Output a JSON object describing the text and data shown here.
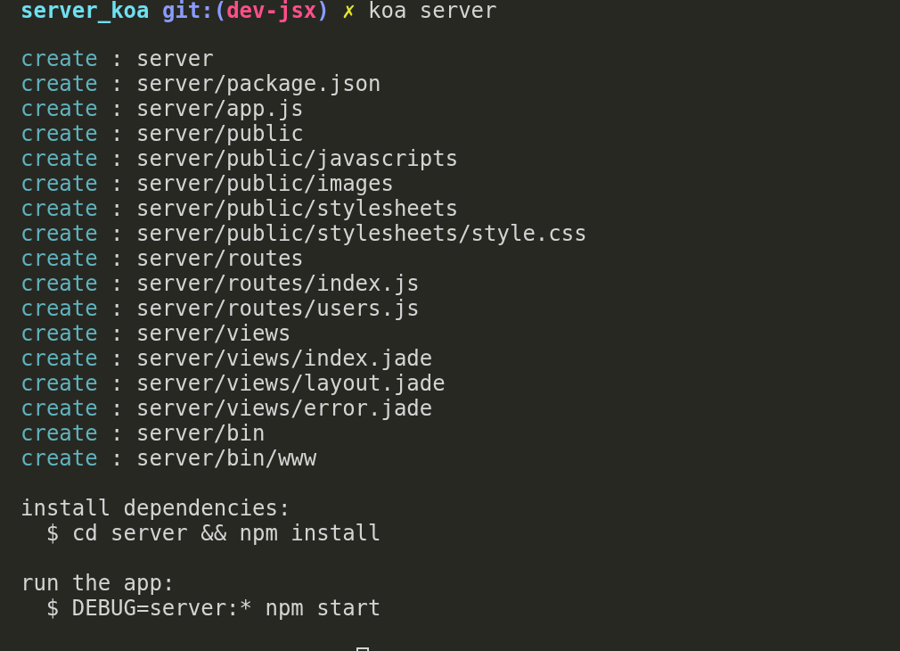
{
  "prompt": {
    "directory": "server_koa",
    "git_prefix": "git:(",
    "branch": "dev-jsx",
    "git_suffix": ")",
    "dirty_mark": "✗",
    "command": "koa server"
  },
  "created": [
    {
      "action": "create",
      "separator": ":",
      "path": "server"
    },
    {
      "action": "create",
      "separator": ":",
      "path": "server/package.json"
    },
    {
      "action": "create",
      "separator": ":",
      "path": "server/app.js"
    },
    {
      "action": "create",
      "separator": ":",
      "path": "server/public"
    },
    {
      "action": "create",
      "separator": ":",
      "path": "server/public/javascripts"
    },
    {
      "action": "create",
      "separator": ":",
      "path": "server/public/images"
    },
    {
      "action": "create",
      "separator": ":",
      "path": "server/public/stylesheets"
    },
    {
      "action": "create",
      "separator": ":",
      "path": "server/public/stylesheets/style.css"
    },
    {
      "action": "create",
      "separator": ":",
      "path": "server/routes"
    },
    {
      "action": "create",
      "separator": ":",
      "path": "server/routes/index.js"
    },
    {
      "action": "create",
      "separator": ":",
      "path": "server/routes/users.js"
    },
    {
      "action": "create",
      "separator": ":",
      "path": "server/views"
    },
    {
      "action": "create",
      "separator": ":",
      "path": "server/views/index.jade"
    },
    {
      "action": "create",
      "separator": ":",
      "path": "server/views/layout.jade"
    },
    {
      "action": "create",
      "separator": ":",
      "path": "server/views/error.jade"
    },
    {
      "action": "create",
      "separator": ":",
      "path": "server/bin"
    },
    {
      "action": "create",
      "separator": ":",
      "path": "server/bin/www"
    }
  ],
  "sections": [
    {
      "heading": "install dependencies:",
      "command": "$ cd server && npm install"
    },
    {
      "heading": "run the app:",
      "command": "$ DEBUG=server:* npm start"
    }
  ]
}
